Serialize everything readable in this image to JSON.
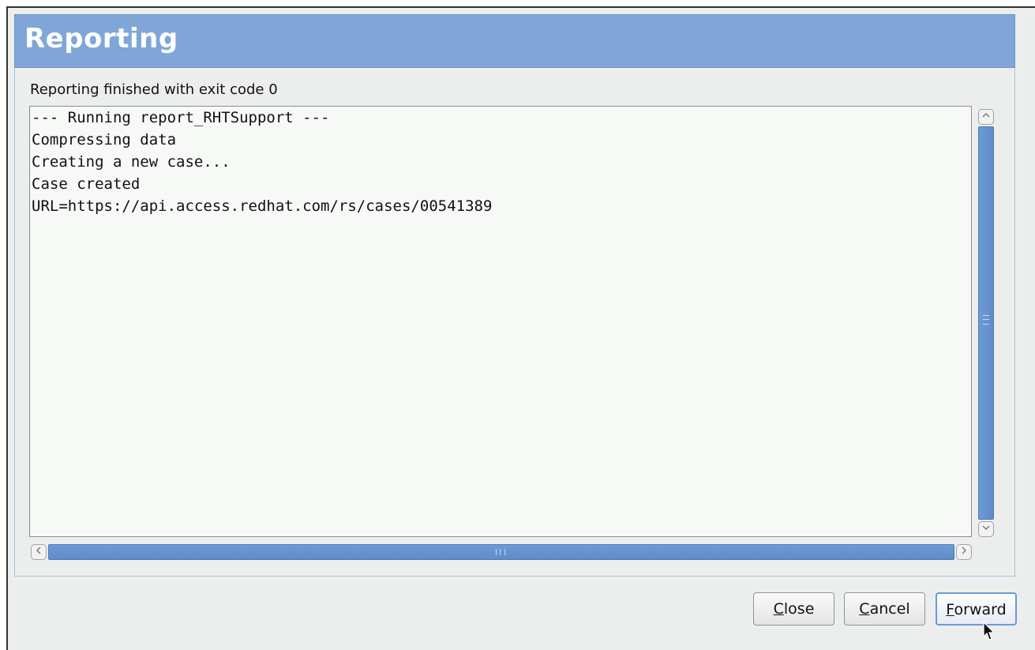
{
  "header": {
    "title": "Reporting"
  },
  "status": {
    "label": "Reporting finished with exit code 0"
  },
  "log": {
    "lines": [
      "--- Running report_RHTSupport ---",
      "Compressing data",
      "Creating a new case...",
      "Case created",
      "URL=https://api.access.redhat.com/rs/cases/00541389"
    ]
  },
  "buttons": {
    "close": {
      "mnemonic": "C",
      "rest": "lose"
    },
    "cancel": {
      "mnemonic": "C",
      "rest": "ancel"
    },
    "forward": {
      "mnemonic": "F",
      "rest": "orward"
    }
  },
  "icons": {
    "scroll_up": "chevron-up-icon",
    "scroll_down": "chevron-down-icon",
    "scroll_left": "chevron-left-icon",
    "scroll_right": "chevron-right-icon"
  },
  "colors": {
    "header_bg": "#7fa6d6",
    "scroll_thumb": "#6e9ad6"
  }
}
